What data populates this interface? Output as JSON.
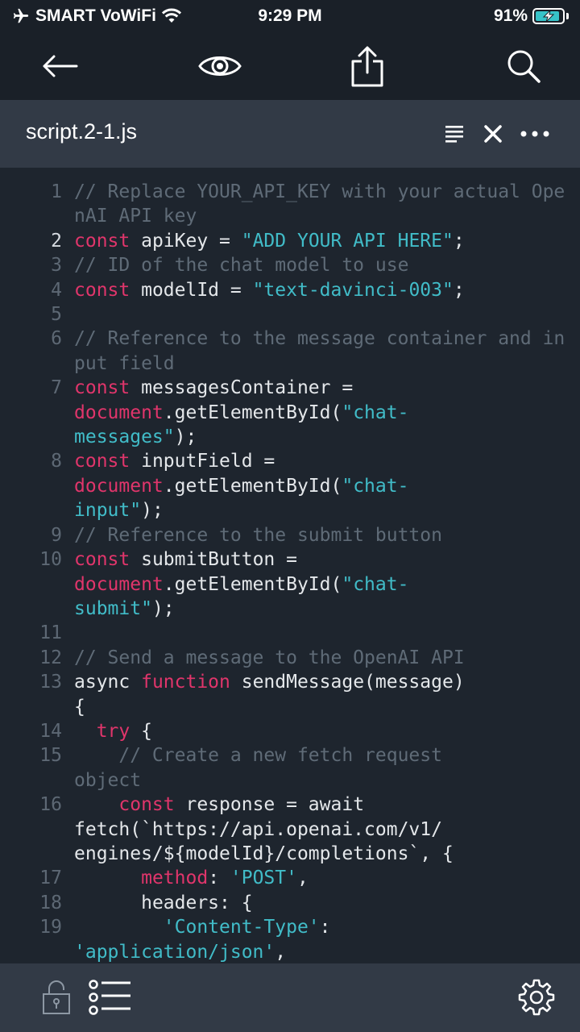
{
  "status_bar": {
    "carrier": "SMART VoWiFi",
    "time": "9:29 PM",
    "battery_text": "91%",
    "battery_level": 0.91
  },
  "toolbar": {
    "back_icon": "arrow-left-icon",
    "preview_icon": "eye-icon",
    "share_icon": "share-icon",
    "search_icon": "search-icon"
  },
  "file": {
    "name": "script.2-1.js",
    "actions": [
      "wrap-lines-icon",
      "close-icon",
      "more-icon"
    ]
  },
  "colors": {
    "comment": "#5f6b77",
    "keyword": "#e0356b",
    "string": "#41bcc8",
    "plain": "#e4e7ea",
    "background": "#1e252e",
    "header": "#323a46"
  },
  "code": {
    "active_line": 2,
    "lines": [
      {
        "n": "1",
        "tokens": [
          {
            "t": "cm",
            "v": "// Replace YOUR_API_KEY with your actual OpenAI API key"
          }
        ]
      },
      {
        "n": "2",
        "tokens": [
          {
            "t": "kw",
            "v": "const"
          },
          {
            "t": "pl",
            "v": " apiKey = "
          },
          {
            "t": "str",
            "v": "\"ADD YOUR API HERE\""
          },
          {
            "t": "pl",
            "v": ";"
          }
        ]
      },
      {
        "n": "3",
        "tokens": [
          {
            "t": "cm",
            "v": "// ID of the chat model to use"
          }
        ]
      },
      {
        "n": "4",
        "tokens": [
          {
            "t": "kw",
            "v": "const"
          },
          {
            "t": "pl",
            "v": " modelId = "
          },
          {
            "t": "str",
            "v": "\"text-davinci-003\""
          },
          {
            "t": "pl",
            "v": ";"
          }
        ]
      },
      {
        "n": "5",
        "tokens": []
      },
      {
        "n": "6",
        "tokens": [
          {
            "t": "cm",
            "v": "// Reference to the message container and input field"
          }
        ]
      },
      {
        "n": "7",
        "tokens": [
          {
            "t": "kw",
            "v": "const"
          },
          {
            "t": "pl",
            "v": " messagesContainer =\n"
          },
          {
            "t": "kw",
            "v": "document"
          },
          {
            "t": "pl",
            "v": ".getElementById("
          },
          {
            "t": "str",
            "v": "\"chat-\nmessages\""
          },
          {
            "t": "pl",
            "v": ");"
          }
        ]
      },
      {
        "n": "8",
        "tokens": [
          {
            "t": "kw",
            "v": "const"
          },
          {
            "t": "pl",
            "v": " inputField =\n"
          },
          {
            "t": "kw",
            "v": "document"
          },
          {
            "t": "pl",
            "v": ".getElementById("
          },
          {
            "t": "str",
            "v": "\"chat-\ninput\""
          },
          {
            "t": "pl",
            "v": ");"
          }
        ]
      },
      {
        "n": "9",
        "tokens": [
          {
            "t": "cm",
            "v": "// Reference to the submit button"
          }
        ]
      },
      {
        "n": "10",
        "tokens": [
          {
            "t": "kw",
            "v": "const"
          },
          {
            "t": "pl",
            "v": " submitButton =\n"
          },
          {
            "t": "kw",
            "v": "document"
          },
          {
            "t": "pl",
            "v": ".getElementById("
          },
          {
            "t": "str",
            "v": "\"chat-\nsubmit\""
          },
          {
            "t": "pl",
            "v": ");"
          }
        ]
      },
      {
        "n": "11",
        "tokens": []
      },
      {
        "n": "12",
        "tokens": [
          {
            "t": "cm",
            "v": "// Send a message to the OpenAI API"
          }
        ]
      },
      {
        "n": "13",
        "tokens": [
          {
            "t": "pl",
            "v": "async "
          },
          {
            "t": "kw",
            "v": "function"
          },
          {
            "t": "pl",
            "v": " sendMessage(message)\n{"
          }
        ]
      },
      {
        "n": "14",
        "tokens": [
          {
            "t": "pl",
            "v": "  "
          },
          {
            "t": "kw",
            "v": "try"
          },
          {
            "t": "pl",
            "v": " {"
          }
        ]
      },
      {
        "n": "15",
        "tokens": [
          {
            "t": "pl",
            "v": "    "
          },
          {
            "t": "cm",
            "v": "// Create a new fetch request\nobject"
          }
        ]
      },
      {
        "n": "16",
        "tokens": [
          {
            "t": "pl",
            "v": "    "
          },
          {
            "t": "kw",
            "v": "const"
          },
          {
            "t": "pl",
            "v": " response = await\nfetch(`https://api.openai.com/v1/\nengines/${modelId}/completions`, {"
          }
        ]
      },
      {
        "n": "17",
        "tokens": [
          {
            "t": "pl",
            "v": "      "
          },
          {
            "t": "kw",
            "v": "method"
          },
          {
            "t": "pl",
            "v": ": "
          },
          {
            "t": "str",
            "v": "'POST'"
          },
          {
            "t": "pl",
            "v": ","
          }
        ]
      },
      {
        "n": "18",
        "tokens": [
          {
            "t": "pl",
            "v": "      headers: {"
          }
        ]
      },
      {
        "n": "19",
        "tokens": [
          {
            "t": "pl",
            "v": "        "
          },
          {
            "t": "str",
            "v": "'Content-Type'"
          },
          {
            "t": "pl",
            "v": ":\n"
          },
          {
            "t": "str",
            "v": "'application/json'"
          },
          {
            "t": "pl",
            "v": ","
          }
        ]
      }
    ]
  },
  "bottom_bar": {
    "lock_icon": "lock-icon",
    "list_icon": "list-icon",
    "settings_icon": "gear-icon"
  }
}
